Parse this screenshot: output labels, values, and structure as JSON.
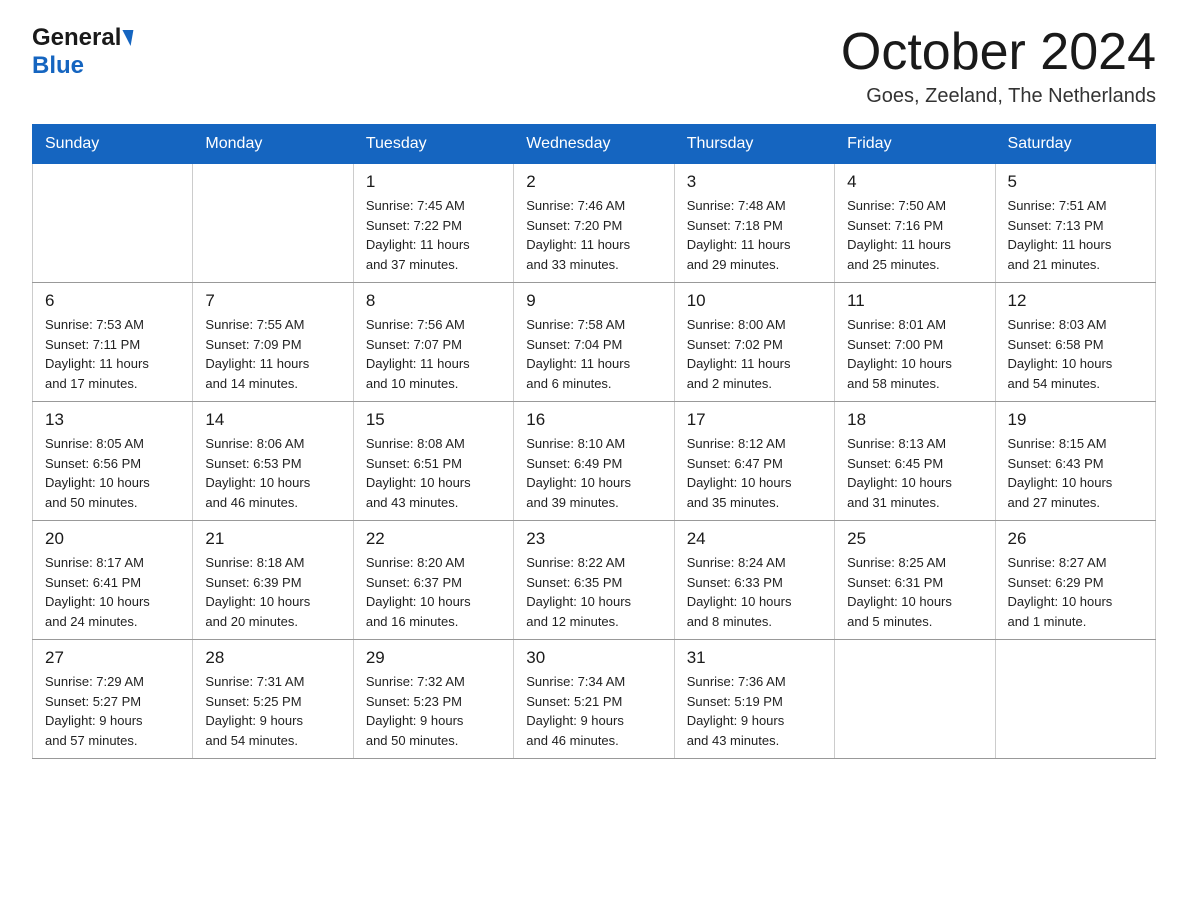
{
  "header": {
    "logo_general": "General",
    "logo_blue": "Blue",
    "month_year": "October 2024",
    "location": "Goes, Zeeland, The Netherlands"
  },
  "days_of_week": [
    "Sunday",
    "Monday",
    "Tuesday",
    "Wednesday",
    "Thursday",
    "Friday",
    "Saturday"
  ],
  "weeks": [
    [
      {
        "day": "",
        "info": ""
      },
      {
        "day": "",
        "info": ""
      },
      {
        "day": "1",
        "info": "Sunrise: 7:45 AM\nSunset: 7:22 PM\nDaylight: 11 hours\nand 37 minutes."
      },
      {
        "day": "2",
        "info": "Sunrise: 7:46 AM\nSunset: 7:20 PM\nDaylight: 11 hours\nand 33 minutes."
      },
      {
        "day": "3",
        "info": "Sunrise: 7:48 AM\nSunset: 7:18 PM\nDaylight: 11 hours\nand 29 minutes."
      },
      {
        "day": "4",
        "info": "Sunrise: 7:50 AM\nSunset: 7:16 PM\nDaylight: 11 hours\nand 25 minutes."
      },
      {
        "day": "5",
        "info": "Sunrise: 7:51 AM\nSunset: 7:13 PM\nDaylight: 11 hours\nand 21 minutes."
      }
    ],
    [
      {
        "day": "6",
        "info": "Sunrise: 7:53 AM\nSunset: 7:11 PM\nDaylight: 11 hours\nand 17 minutes."
      },
      {
        "day": "7",
        "info": "Sunrise: 7:55 AM\nSunset: 7:09 PM\nDaylight: 11 hours\nand 14 minutes."
      },
      {
        "day": "8",
        "info": "Sunrise: 7:56 AM\nSunset: 7:07 PM\nDaylight: 11 hours\nand 10 minutes."
      },
      {
        "day": "9",
        "info": "Sunrise: 7:58 AM\nSunset: 7:04 PM\nDaylight: 11 hours\nand 6 minutes."
      },
      {
        "day": "10",
        "info": "Sunrise: 8:00 AM\nSunset: 7:02 PM\nDaylight: 11 hours\nand 2 minutes."
      },
      {
        "day": "11",
        "info": "Sunrise: 8:01 AM\nSunset: 7:00 PM\nDaylight: 10 hours\nand 58 minutes."
      },
      {
        "day": "12",
        "info": "Sunrise: 8:03 AM\nSunset: 6:58 PM\nDaylight: 10 hours\nand 54 minutes."
      }
    ],
    [
      {
        "day": "13",
        "info": "Sunrise: 8:05 AM\nSunset: 6:56 PM\nDaylight: 10 hours\nand 50 minutes."
      },
      {
        "day": "14",
        "info": "Sunrise: 8:06 AM\nSunset: 6:53 PM\nDaylight: 10 hours\nand 46 minutes."
      },
      {
        "day": "15",
        "info": "Sunrise: 8:08 AM\nSunset: 6:51 PM\nDaylight: 10 hours\nand 43 minutes."
      },
      {
        "day": "16",
        "info": "Sunrise: 8:10 AM\nSunset: 6:49 PM\nDaylight: 10 hours\nand 39 minutes."
      },
      {
        "day": "17",
        "info": "Sunrise: 8:12 AM\nSunset: 6:47 PM\nDaylight: 10 hours\nand 35 minutes."
      },
      {
        "day": "18",
        "info": "Sunrise: 8:13 AM\nSunset: 6:45 PM\nDaylight: 10 hours\nand 31 minutes."
      },
      {
        "day": "19",
        "info": "Sunrise: 8:15 AM\nSunset: 6:43 PM\nDaylight: 10 hours\nand 27 minutes."
      }
    ],
    [
      {
        "day": "20",
        "info": "Sunrise: 8:17 AM\nSunset: 6:41 PM\nDaylight: 10 hours\nand 24 minutes."
      },
      {
        "day": "21",
        "info": "Sunrise: 8:18 AM\nSunset: 6:39 PM\nDaylight: 10 hours\nand 20 minutes."
      },
      {
        "day": "22",
        "info": "Sunrise: 8:20 AM\nSunset: 6:37 PM\nDaylight: 10 hours\nand 16 minutes."
      },
      {
        "day": "23",
        "info": "Sunrise: 8:22 AM\nSunset: 6:35 PM\nDaylight: 10 hours\nand 12 minutes."
      },
      {
        "day": "24",
        "info": "Sunrise: 8:24 AM\nSunset: 6:33 PM\nDaylight: 10 hours\nand 8 minutes."
      },
      {
        "day": "25",
        "info": "Sunrise: 8:25 AM\nSunset: 6:31 PM\nDaylight: 10 hours\nand 5 minutes."
      },
      {
        "day": "26",
        "info": "Sunrise: 8:27 AM\nSunset: 6:29 PM\nDaylight: 10 hours\nand 1 minute."
      }
    ],
    [
      {
        "day": "27",
        "info": "Sunrise: 7:29 AM\nSunset: 5:27 PM\nDaylight: 9 hours\nand 57 minutes."
      },
      {
        "day": "28",
        "info": "Sunrise: 7:31 AM\nSunset: 5:25 PM\nDaylight: 9 hours\nand 54 minutes."
      },
      {
        "day": "29",
        "info": "Sunrise: 7:32 AM\nSunset: 5:23 PM\nDaylight: 9 hours\nand 50 minutes."
      },
      {
        "day": "30",
        "info": "Sunrise: 7:34 AM\nSunset: 5:21 PM\nDaylight: 9 hours\nand 46 minutes."
      },
      {
        "day": "31",
        "info": "Sunrise: 7:36 AM\nSunset: 5:19 PM\nDaylight: 9 hours\nand 43 minutes."
      },
      {
        "day": "",
        "info": ""
      },
      {
        "day": "",
        "info": ""
      }
    ]
  ]
}
